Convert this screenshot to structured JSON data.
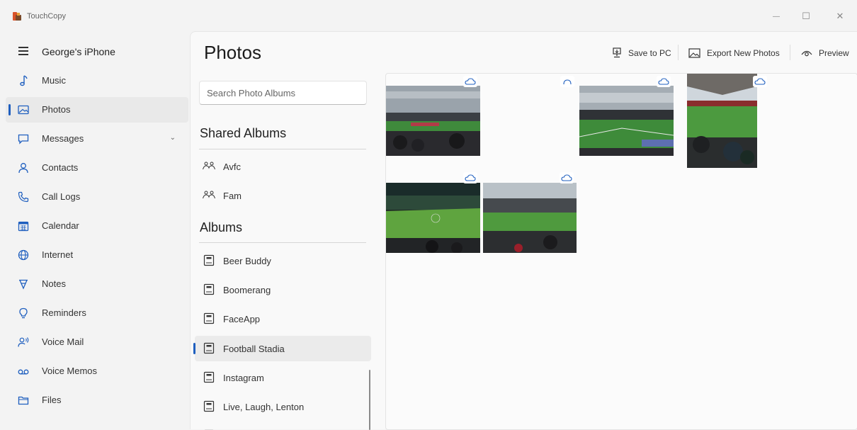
{
  "app": {
    "title": "TouchCopy"
  },
  "window_controls": {
    "minimize": "—",
    "maximize": "☐",
    "close": "✕"
  },
  "sidebar": {
    "device_name": "George's iPhone",
    "items": [
      {
        "label": "Music",
        "icon": "music-note-icon"
      },
      {
        "label": "Photos",
        "icon": "image-icon",
        "active": true
      },
      {
        "label": "Messages",
        "icon": "chat-bubble-icon",
        "expandable": true
      },
      {
        "label": "Contacts",
        "icon": "person-icon"
      },
      {
        "label": "Call Logs",
        "icon": "phone-icon"
      },
      {
        "label": "Calendar",
        "icon": "calendar-icon"
      },
      {
        "label": "Internet",
        "icon": "globe-icon"
      },
      {
        "label": "Notes",
        "icon": "notes-icon"
      },
      {
        "label": "Reminders",
        "icon": "lightbulb-icon"
      },
      {
        "label": "Voice Mail",
        "icon": "voicemail-person-icon"
      },
      {
        "label": "Voice Memos",
        "icon": "voicemail-icon"
      },
      {
        "label": "Files",
        "icon": "folder-icon"
      }
    ],
    "chevron": "⌄"
  },
  "main": {
    "title": "Photos",
    "toolbar": {
      "save_to_pc": "Save to PC",
      "export_new": "Export New Photos",
      "preview": "Preview"
    },
    "search": {
      "placeholder": "Search Photo Albums",
      "value": ""
    },
    "shared_albums": {
      "header": "Shared Albums",
      "items": [
        "Avfc",
        "Fam"
      ]
    },
    "albums": {
      "header": "Albums",
      "items": [
        "Beer Buddy",
        "Boomerang",
        "FaceApp",
        "Football Stadia",
        "Instagram",
        "Live, Laugh, Lenton"
      ],
      "selected": "Football Stadia"
    }
  },
  "colors": {
    "accent": "#1f5fbf",
    "cloud_icon": "#1f5fbf"
  }
}
